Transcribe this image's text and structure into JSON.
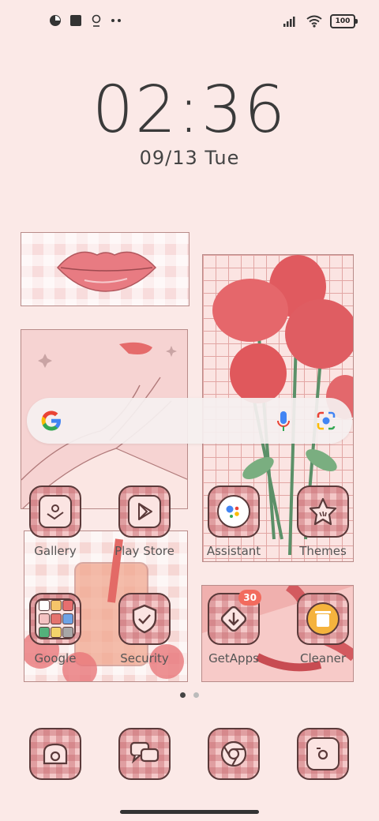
{
  "status_bar": {
    "left_icons": [
      "pie-icon",
      "square-icon",
      "badge-icon",
      "more-dots-icon"
    ],
    "right_icons": [
      "signal-icon",
      "wifi-icon"
    ],
    "battery": "100"
  },
  "clock": {
    "time": "02:36",
    "date": "09/13",
    "weekday": "Tue"
  },
  "search": {
    "google_icon": "google-g-icon",
    "mic_icon": "mic-icon",
    "lens_icon": "lens-icon"
  },
  "apps": [
    {
      "label": "Gallery",
      "icon": "gallery-icon"
    },
    {
      "label": "Play Store",
      "icon": "play-store-icon"
    },
    {
      "label": "Assistant",
      "icon": "assistant-icon"
    },
    {
      "label": "Themes",
      "icon": "themes-icon"
    },
    {
      "label": "Google",
      "icon": "google-folder-icon"
    },
    {
      "label": "Security",
      "icon": "shield-icon"
    },
    {
      "label": "GetApps",
      "icon": "getapps-icon",
      "badge": "30"
    },
    {
      "label": "Cleaner",
      "icon": "trash-icon"
    }
  ],
  "dock": [
    {
      "icon": "phone-icon"
    },
    {
      "icon": "messages-icon"
    },
    {
      "icon": "chrome-icon"
    },
    {
      "icon": "camera-icon"
    }
  ],
  "page_indicator": {
    "pages": 2,
    "current": 0
  },
  "colors": {
    "background": "#fbe9e7",
    "accent": "#e0676a",
    "badge": "#f26b5e"
  }
}
